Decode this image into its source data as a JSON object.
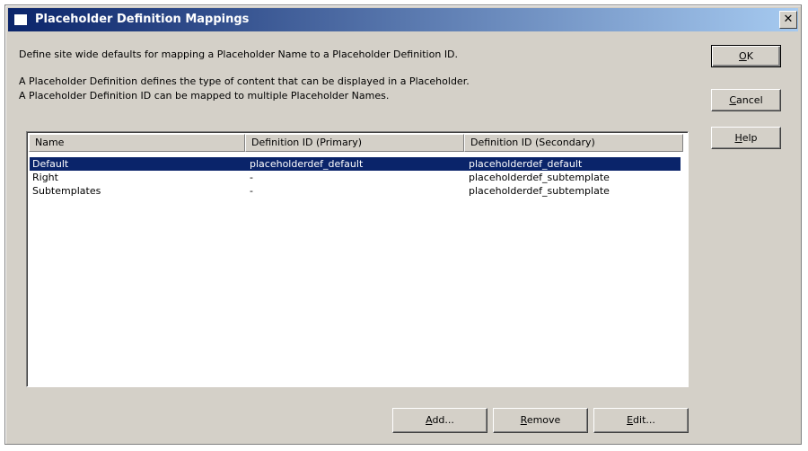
{
  "window": {
    "title": "Placeholder Definition Mappings",
    "close_label": "✕"
  },
  "description": {
    "line1": "Define site wide defaults for mapping a Placeholder Name to a Placeholder Definition ID.",
    "line2": "A Placeholder Definition defines the type of content that can be displayed in a Placeholder.",
    "line3": "A Placeholder Definition ID can be mapped to multiple Placeholder Names."
  },
  "buttons": {
    "ok": {
      "pre": "",
      "accel": "O",
      "post": "K"
    },
    "cancel": {
      "pre": "",
      "accel": "C",
      "post": "ancel"
    },
    "help": {
      "pre": "",
      "accel": "H",
      "post": "elp"
    },
    "add": {
      "pre": "",
      "accel": "A",
      "post": "dd..."
    },
    "remove": {
      "pre": "",
      "accel": "R",
      "post": "emove"
    },
    "edit": {
      "pre": "",
      "accel": "E",
      "post": "dit..."
    }
  },
  "table": {
    "columns": [
      "Name",
      "Definition ID (Primary)",
      "Definition ID (Secondary)"
    ],
    "rows": [
      {
        "name": "Default",
        "primary": "placeholderdef_default",
        "secondary": "placeholderdef_default",
        "selected": true
      },
      {
        "name": "Right",
        "primary": "-",
        "secondary": "placeholderdef_subtemplate",
        "selected": false
      },
      {
        "name": "Subtemplates",
        "primary": "-",
        "secondary": "placeholderdef_subtemplate",
        "selected": false
      }
    ]
  },
  "colors": {
    "selection": "#0a246a",
    "dialog_bg": "#d4d0c8"
  }
}
